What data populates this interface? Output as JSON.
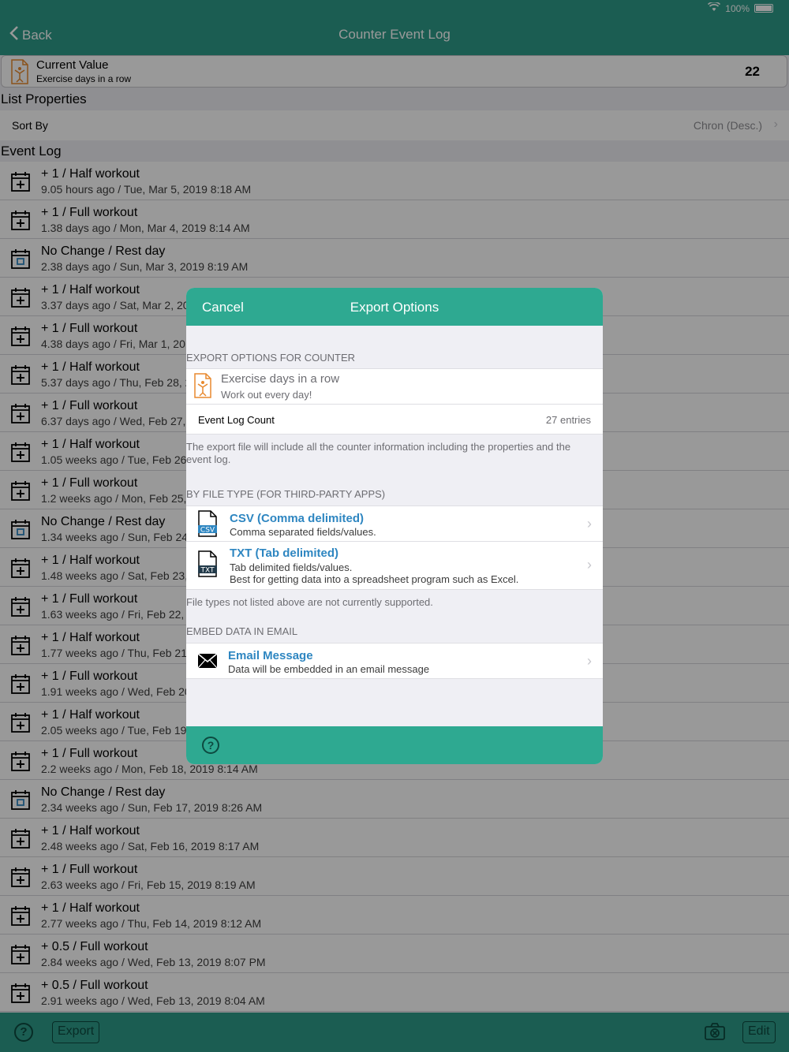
{
  "status_bar": {
    "battery": "100%"
  },
  "nav": {
    "back": "Back",
    "title": "Counter Event Log"
  },
  "current_value": {
    "title": "Current Value",
    "subtitle": "Exercise days in a row",
    "value": "22"
  },
  "list_properties": {
    "header": "List Properties",
    "sort_by_label": "Sort By",
    "sort_by_value": "Chron (Desc.)"
  },
  "event_log": {
    "header": "Event Log",
    "items": [
      {
        "icon": "calendar-plus",
        "title": "+ 1 / Half workout",
        "sub": "9.05 hours ago / Tue, Mar 5, 2019 8:18 AM"
      },
      {
        "icon": "calendar-plus",
        "title": "+ 1 / Full workout",
        "sub": "1.38 days ago / Mon, Mar 4, 2019 8:14 AM"
      },
      {
        "icon": "calendar-none",
        "title": "No Change / Rest day",
        "sub": "2.38 days ago / Sun, Mar 3, 2019 8:19 AM"
      },
      {
        "icon": "calendar-plus",
        "title": "+ 1 / Half workout",
        "sub": "3.37 days ago / Sat, Mar 2, 20"
      },
      {
        "icon": "calendar-plus",
        "title": "+ 1 / Full workout",
        "sub": "4.38 days ago / Fri, Mar 1, 20"
      },
      {
        "icon": "calendar-plus",
        "title": "+ 1 / Half workout",
        "sub": "5.37 days ago / Thu, Feb 28, 2"
      },
      {
        "icon": "calendar-plus",
        "title": "+ 1 / Full workout",
        "sub": "6.37 days ago / Wed, Feb 27,"
      },
      {
        "icon": "calendar-plus",
        "title": "+ 1 / Half workout",
        "sub": "1.05 weeks ago / Tue, Feb 26,"
      },
      {
        "icon": "calendar-plus",
        "title": "+ 1 / Full workout",
        "sub": "1.2 weeks ago / Mon, Feb 25,"
      },
      {
        "icon": "calendar-none",
        "title": "No Change / Rest day",
        "sub": "1.34 weeks ago / Sun, Feb 24"
      },
      {
        "icon": "calendar-plus",
        "title": "+ 1 / Half workout",
        "sub": "1.48 weeks ago / Sat, Feb 23,"
      },
      {
        "icon": "calendar-plus",
        "title": "+ 1 / Full workout",
        "sub": "1.63 weeks ago / Fri, Feb 22,"
      },
      {
        "icon": "calendar-plus",
        "title": "+ 1 / Half workout",
        "sub": "1.77 weeks ago / Thu, Feb 21,"
      },
      {
        "icon": "calendar-plus",
        "title": "+ 1 / Full workout",
        "sub": "1.91 weeks ago / Wed, Feb 20"
      },
      {
        "icon": "calendar-plus",
        "title": "+ 1 / Half workout",
        "sub": "2.05 weeks ago / Tue, Feb 19,"
      },
      {
        "icon": "calendar-plus",
        "title": "+ 1 / Full workout",
        "sub": "2.2 weeks ago / Mon, Feb 18, 2019 8:14 AM"
      },
      {
        "icon": "calendar-none",
        "title": "No Change / Rest day",
        "sub": "2.34 weeks ago / Sun, Feb 17, 2019 8:26 AM"
      },
      {
        "icon": "calendar-plus",
        "title": "+ 1 / Half workout",
        "sub": "2.48 weeks ago / Sat, Feb 16, 2019 8:17 AM"
      },
      {
        "icon": "calendar-plus",
        "title": "+ 1 / Full workout",
        "sub": "2.63 weeks ago / Fri, Feb 15, 2019 8:19 AM"
      },
      {
        "icon": "calendar-plus",
        "title": "+ 1 / Half workout",
        "sub": "2.77 weeks ago / Thu, Feb 14, 2019 8:12 AM"
      },
      {
        "icon": "calendar-plus",
        "title": "+ 0.5 / Full workout",
        "sub": "2.84 weeks ago / Wed, Feb 13, 2019 8:07 PM"
      },
      {
        "icon": "calendar-plus",
        "title": "+ 0.5 / Full workout",
        "sub": "2.91 weeks ago / Wed, Feb 13, 2019 8:04 AM"
      }
    ]
  },
  "toolbar": {
    "export": "Export",
    "edit": "Edit"
  },
  "modal": {
    "cancel": "Cancel",
    "title": "Export Options",
    "section_counter": "EXPORT OPTIONS FOR COUNTER",
    "counter_name": "Exercise days in a row",
    "counter_desc": "Work out every day!",
    "log_count_label": "Event Log Count",
    "log_count_value": "27 entries",
    "note_include": "The export file will include all the counter information including the properties and the event log.",
    "section_file_type": "BY FILE TYPE (FOR THIRD-PARTY APPS)",
    "csv_title": "CSV (Comma delimited)",
    "csv_sub": "Comma separated fields/values.",
    "csv_badge": "CSV",
    "txt_title": "TXT (Tab delimited)",
    "txt_sub1": "Tab delimited fields/values.",
    "txt_sub2": "Best for getting data into a spreadsheet program such as Excel.",
    "txt_badge": "TXT",
    "note_unsupported": "File types not listed above are not currently supported.",
    "section_email": "EMBED DATA IN EMAIL",
    "email_title": "Email Message",
    "email_sub": "Data will be embedded in an email message"
  },
  "colors": {
    "accent": "#2e9c89",
    "link": "#2e86c1",
    "icon_orange": "#e8892e"
  }
}
